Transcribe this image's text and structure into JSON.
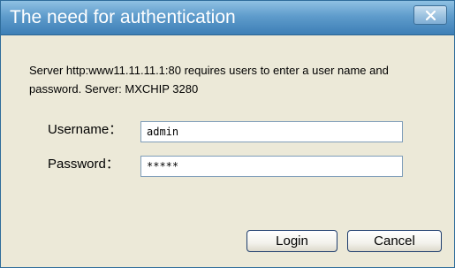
{
  "dialog": {
    "title": "The need for authentication",
    "close_icon": "close-x",
    "message": "Server http:www11.11.11.1:80 requires users to enter a user name and password. Server: MXCHIP 3280"
  },
  "form": {
    "username_label": "Username：",
    "username_value": "admin",
    "password_label": "Password：",
    "password_value": "*****"
  },
  "buttons": {
    "login_label": "Login",
    "cancel_label": "Cancel"
  },
  "colors": {
    "titlebar": "#5f9ccc",
    "window_bg": "#ece9d8",
    "input_border": "#7f9db9"
  }
}
